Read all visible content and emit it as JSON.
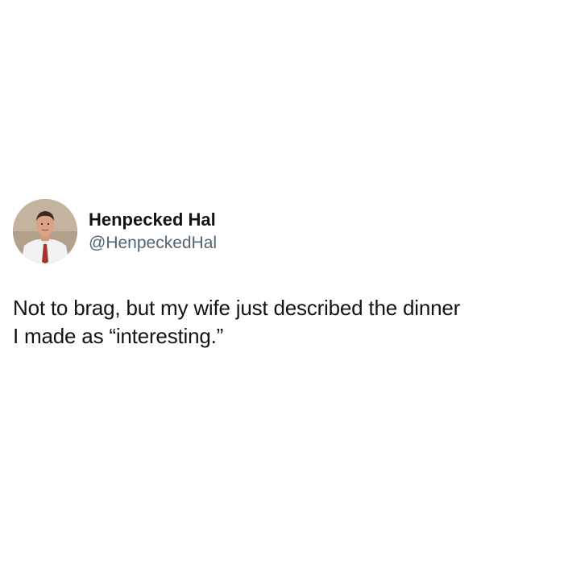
{
  "tweet": {
    "author": {
      "display_name": "Henpecked Hal",
      "handle": "@HenpeckedHal",
      "avatar_icon": "profile-photo-man-in-shirt-and-tie"
    },
    "text": "Not to brag, but my wife just described the dinner\nI made as “interesting.”"
  },
  "colors": {
    "background": "#ffffff",
    "primary_text": "#0f1419",
    "secondary_text": "#536471"
  }
}
